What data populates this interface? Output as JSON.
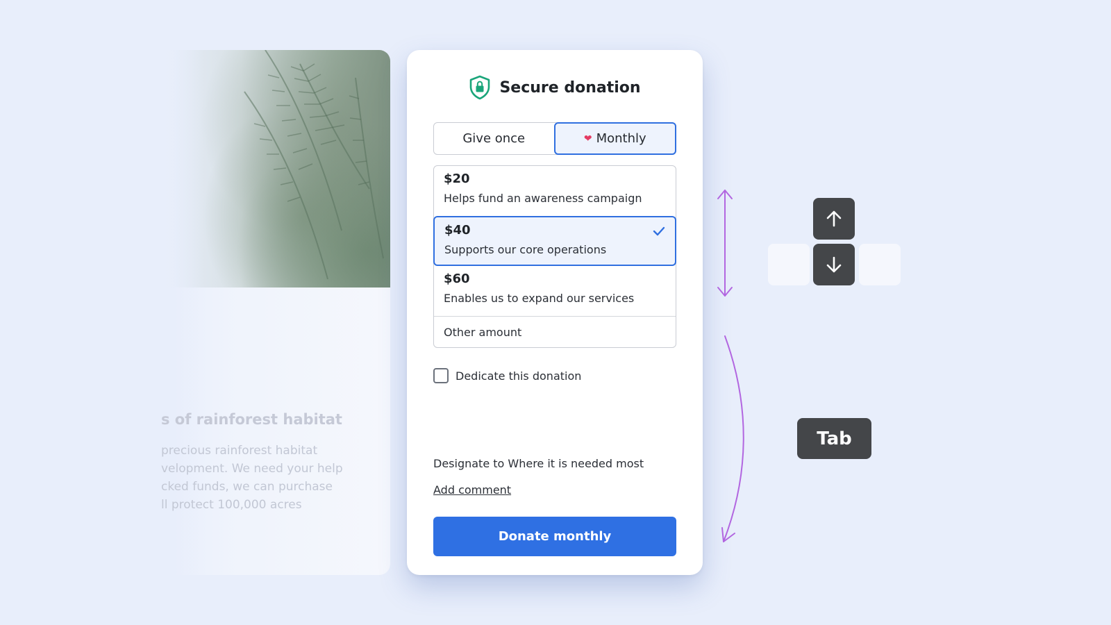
{
  "background_page": {
    "heading_fragment": "s of rainforest habitat",
    "body_lines": [
      "precious rainforest habitat",
      "velopment. We need your help",
      "cked funds, we can purchase",
      "ll protect 100,000 acres"
    ]
  },
  "modal": {
    "title": "Secure donation",
    "title_icon": "shield-lock-icon",
    "frequency": {
      "options": [
        "Give once",
        "Monthly"
      ],
      "selected": "Monthly"
    },
    "amounts": [
      {
        "value": "$20",
        "description": "Helps fund an awareness campaign",
        "selected": false
      },
      {
        "value": "$40",
        "description": "Supports our core operations",
        "selected": true
      },
      {
        "value": "$60",
        "description": "Enables us to expand our services",
        "selected": false
      }
    ],
    "other_amount_label": "Other amount",
    "dedicate_label": "Dedicate this donation",
    "dedicate_checked": false,
    "designate_text": "Designate to Where it is needed most",
    "add_comment_label": "Add comment",
    "submit_label": "Donate monthly"
  },
  "annotations": {
    "arrow_keys": [
      "arrow-up-icon",
      "arrow-down-icon"
    ],
    "tab_key_label": "Tab",
    "accent_color": "#b266e0"
  },
  "colors": {
    "primary": "#2f70e3",
    "shield": "#1aa57a",
    "heart": "#e43b63",
    "page_background": "#e8eefb",
    "key_dark": "#444649"
  }
}
